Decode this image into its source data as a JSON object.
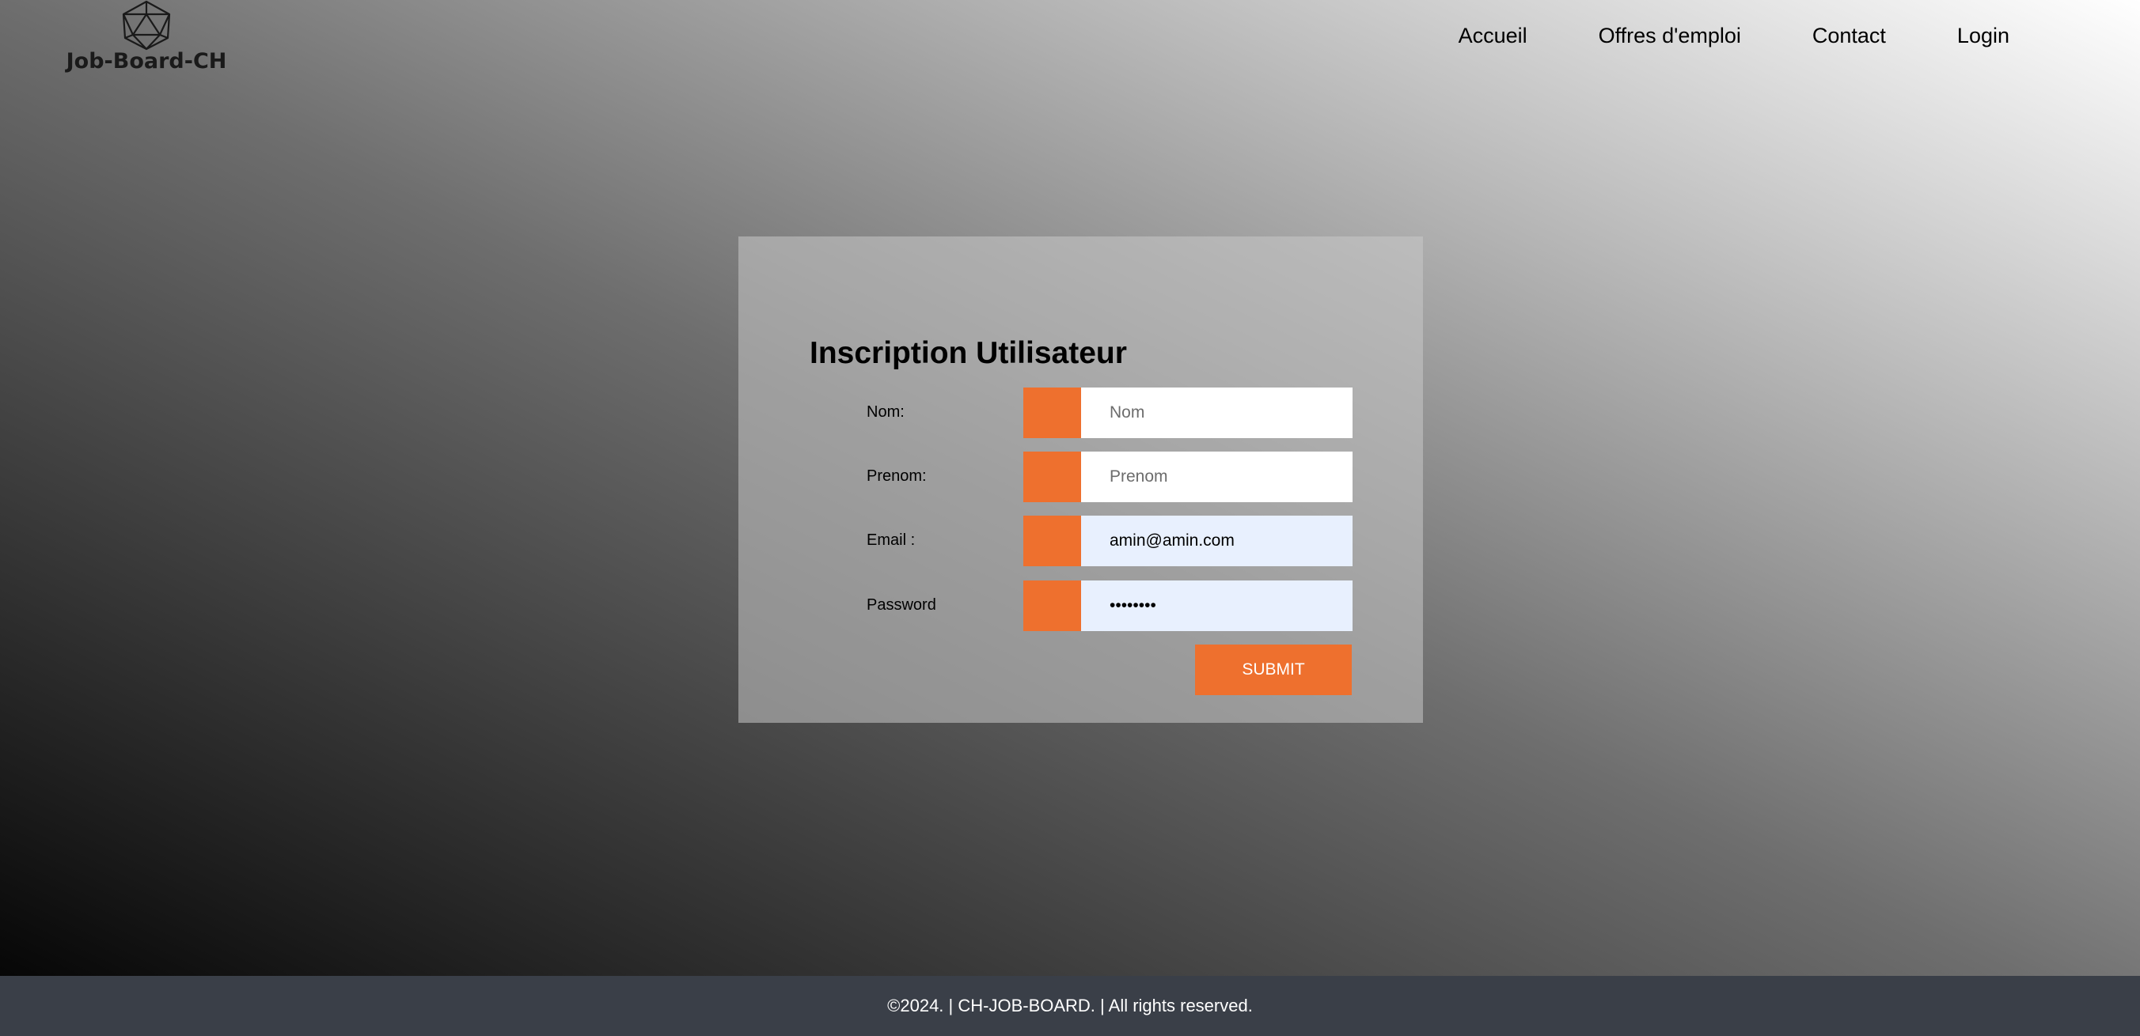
{
  "header": {
    "logo_text": "Job-Board-CH",
    "logo_icon": "icosahedron-icon",
    "nav": [
      {
        "label": "Accueil"
      },
      {
        "label": "Offres d'emploi"
      },
      {
        "label": "Contact"
      },
      {
        "label": "Login"
      }
    ]
  },
  "form": {
    "title": "Inscription Utilisateur",
    "fields": [
      {
        "label": "Nom:",
        "placeholder": "Nom",
        "value": ""
      },
      {
        "label": "Prenom:",
        "placeholder": "Prenom",
        "value": ""
      },
      {
        "label": "Email :",
        "placeholder": "",
        "value": "amin@amin.com"
      },
      {
        "label": "Password",
        "placeholder": "",
        "value": "••••••••"
      }
    ],
    "submit_label": "SUBMIT"
  },
  "footer": {
    "text": "©2024. | CH-JOB-BOARD. | All rights reserved."
  },
  "colors": {
    "accent": "#ee702e",
    "footer_bg": "#3a3f48",
    "autofill_bg": "#e8f0fe"
  }
}
